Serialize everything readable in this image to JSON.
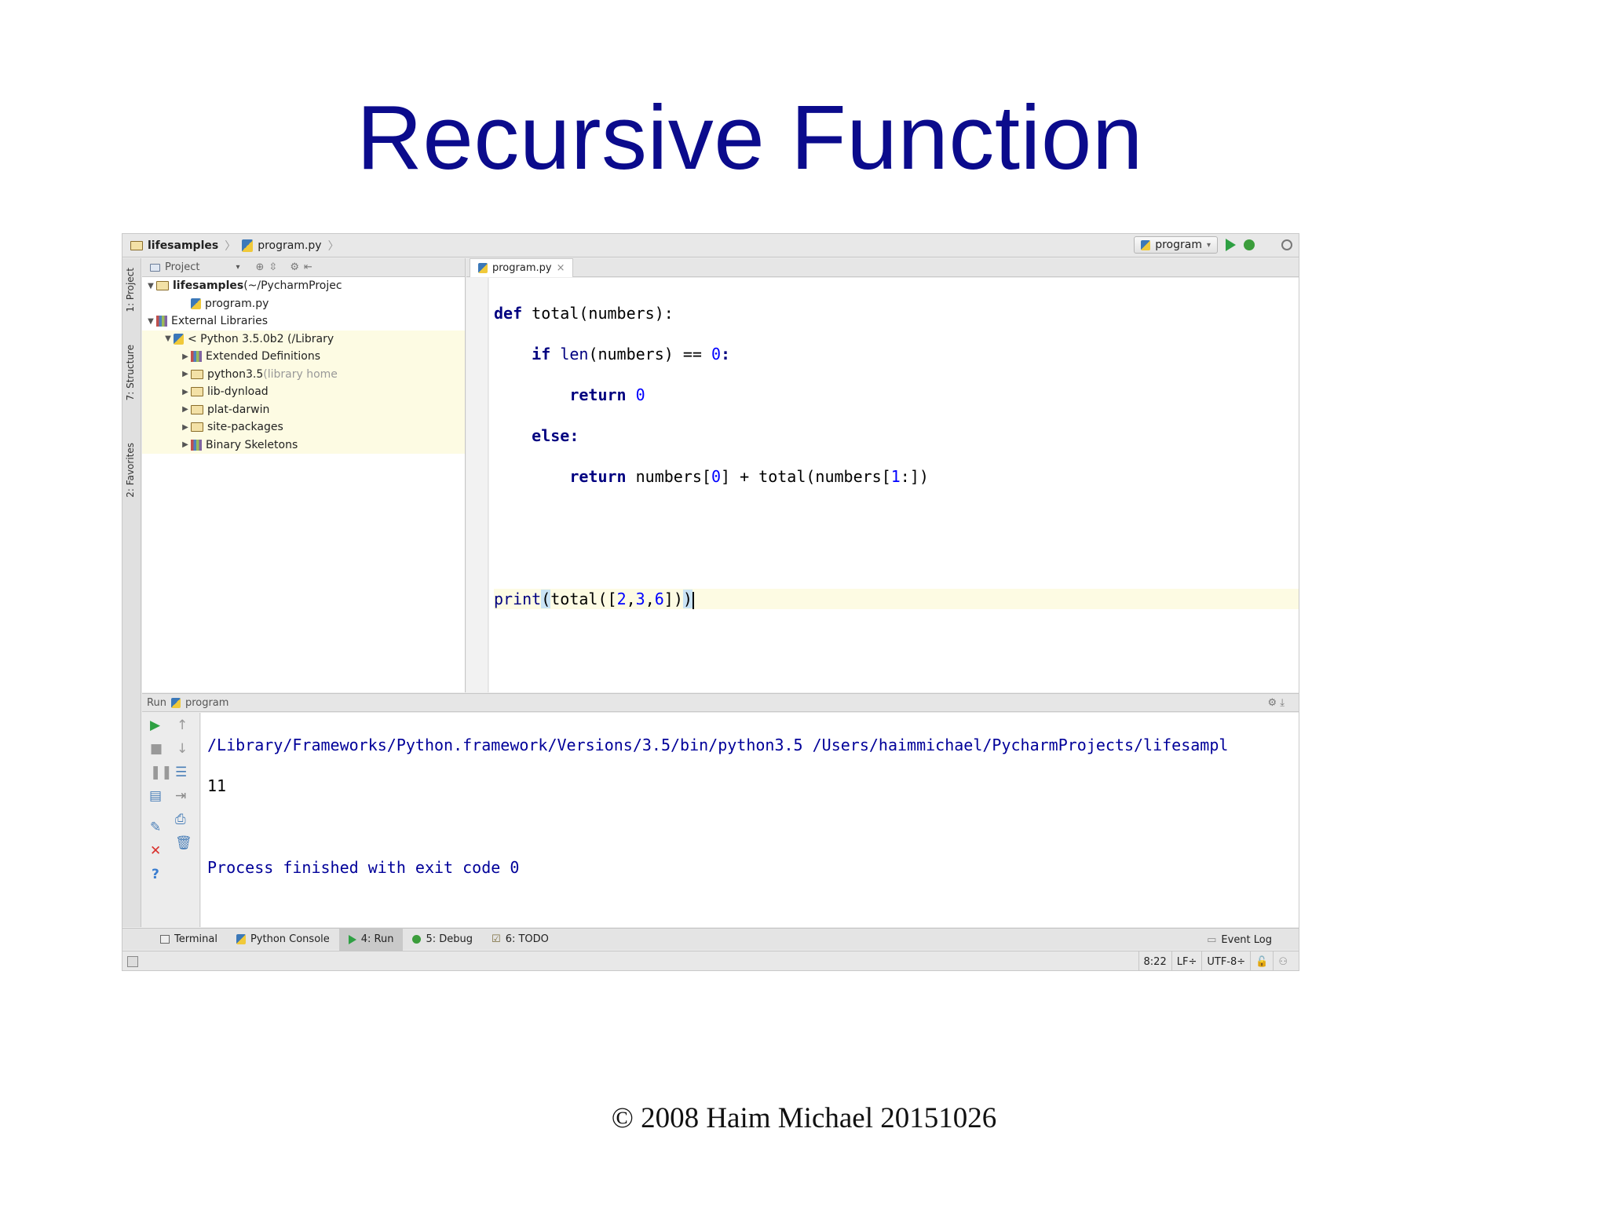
{
  "slide": {
    "title": "Recursive Function",
    "footer": "© 2008 Haim Michael 20151026"
  },
  "navbar": {
    "crumb_project": "lifesamples",
    "crumb_file": "program.py",
    "run_config": "program"
  },
  "left_strip": {
    "tab_project": "1: Project",
    "tab_structure": "7: Structure",
    "tab_favorites": "2: Favorites"
  },
  "project_panel": {
    "header": "Project",
    "tree": [
      {
        "label": "lifesamples",
        "suffix": " (~/PycharmProjec",
        "type": "folder",
        "indent": 0,
        "arrow": "▼"
      },
      {
        "label": "program.py",
        "suffix": "",
        "type": "py",
        "indent": 2,
        "arrow": ""
      },
      {
        "label": "External Libraries",
        "suffix": "",
        "type": "lib",
        "indent": 0,
        "arrow": "▼"
      },
      {
        "label": "< Python 3.5.0b2 (/Library",
        "suffix": "",
        "type": "py",
        "indent": 1,
        "arrow": "▼"
      },
      {
        "label": "Extended Definitions",
        "suffix": "",
        "type": "lib",
        "indent": 2,
        "arrow": "▶"
      },
      {
        "label": "python3.5",
        "suffix": " (library home",
        "type": "folder",
        "indent": 2,
        "arrow": "▶"
      },
      {
        "label": "lib-dynload",
        "suffix": "",
        "type": "folder",
        "indent": 2,
        "arrow": "▶"
      },
      {
        "label": "plat-darwin",
        "suffix": "",
        "type": "folder",
        "indent": 2,
        "arrow": "▶"
      },
      {
        "label": "site-packages",
        "suffix": "",
        "type": "folder",
        "indent": 2,
        "arrow": "▶"
      },
      {
        "label": "Binary Skeletons",
        "suffix": "",
        "type": "lib",
        "indent": 2,
        "arrow": "▶"
      }
    ]
  },
  "editor": {
    "tab_label": "program.py",
    "tab_close": "×",
    "code": {
      "l1_kw": "def",
      "l1_rest": " total(numbers):",
      "l2_kw": "if",
      "l2_builtin": "len",
      "l2_rest": "(numbers) == ",
      "l2_num": "0",
      "l2_colon": ":",
      "l3_kw": "return",
      "l3_num": "0",
      "l4_kw": "else",
      "l4_colon": ":",
      "l5_kw": "return",
      "l5_a": " numbers[",
      "l5_num0": "0",
      "l5_b": "] + total(numbers[",
      "l5_num1": "1",
      "l5_c": ":])",
      "l8_builtin": "print",
      "l8_open": "(",
      "l8_a": "total([",
      "l8_n1": "2",
      "l8_comma1": ",",
      "l8_n2": "3",
      "l8_comma2": ",",
      "l8_n3": "6",
      "l8_b": "])",
      "l8_close": ")"
    }
  },
  "run_panel": {
    "label": "Run",
    "config": "program",
    "console": {
      "command": "/Library/Frameworks/Python.framework/Versions/3.5/bin/python3.5 /Users/haimmichael/PycharmProjects/lifesampl",
      "output": "11",
      "process": "Process finished with exit code 0"
    }
  },
  "bottom_tabs": {
    "terminal": "Terminal",
    "python_console": "Python Console",
    "run": "4: Run",
    "debug": "5: Debug",
    "todo": "6: TODO",
    "event_log": "Event Log"
  },
  "status": {
    "position": "8:22",
    "line_sep": "LF÷",
    "encoding": "UTF-8÷"
  }
}
